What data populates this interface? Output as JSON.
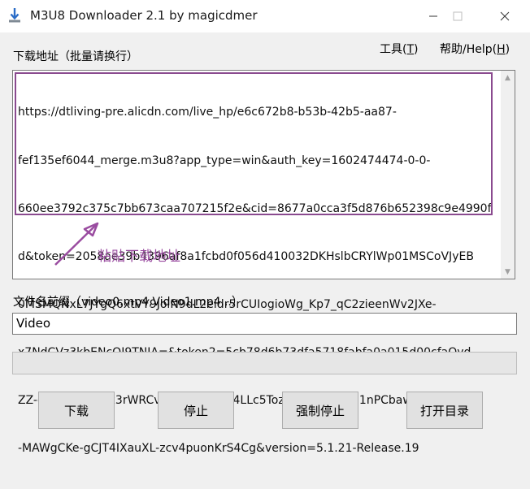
{
  "window": {
    "title": "M3U8 Downloader 2.1 by magicdmer"
  },
  "menu": {
    "tools": "工具(T)",
    "help": "帮助/Help(H)"
  },
  "url_section": {
    "label": "下载地址（批量请换行）",
    "lines": [
      "https://dtliving-pre.alicdn.com/live_hp/e6c672b8-b53b-42b5-aa87-",
      "fef135ef6044_merge.m3u8?app_type=win&auth_key=1602474474-0-0-",
      "660ee3792c375c7bb673caa707215f2e&cid=8677a0cca3f5d876b652398c9e4990f",
      "d&token=2058ae39b4396af8a1fcbd0f056d410032DKHslbCRYlWp01MSCoVJyEB",
      "0MSMQNxL7JYgQ6xtVY9JolN9dL2eidr5rCUIogioWg_Kp7_qC2zieenWv2JXe-",
      "x7NdCVz3kbENcOI9TNIA=&token2=5cb78d6b73dfa5718fabfa0a015d00cfaQyd",
      "ZZ-eERqQ-JfIuIox3rWRCvs6wtLYCqNgI4LLc5TozscinRornEUKI1nPCbawJgf3B-G5",
      "-MAWgCKe-gCJT4IXauXL-zcv4puonKrS4Cg&version=5.1.21-Release.19"
    ],
    "annotation": "粘贴下载地址"
  },
  "prefix_section": {
    "label": "文件名前缀（video0.mp4,Video1.mp4...）",
    "value": "Video"
  },
  "progress": {
    "percent": 0
  },
  "buttons": {
    "download": "下载",
    "stop": "停止",
    "force_stop": "强制停止",
    "open_dir": "打开目录"
  },
  "colors": {
    "annotation": "#9a4ca0",
    "window_bg": "#f0f0f0"
  }
}
